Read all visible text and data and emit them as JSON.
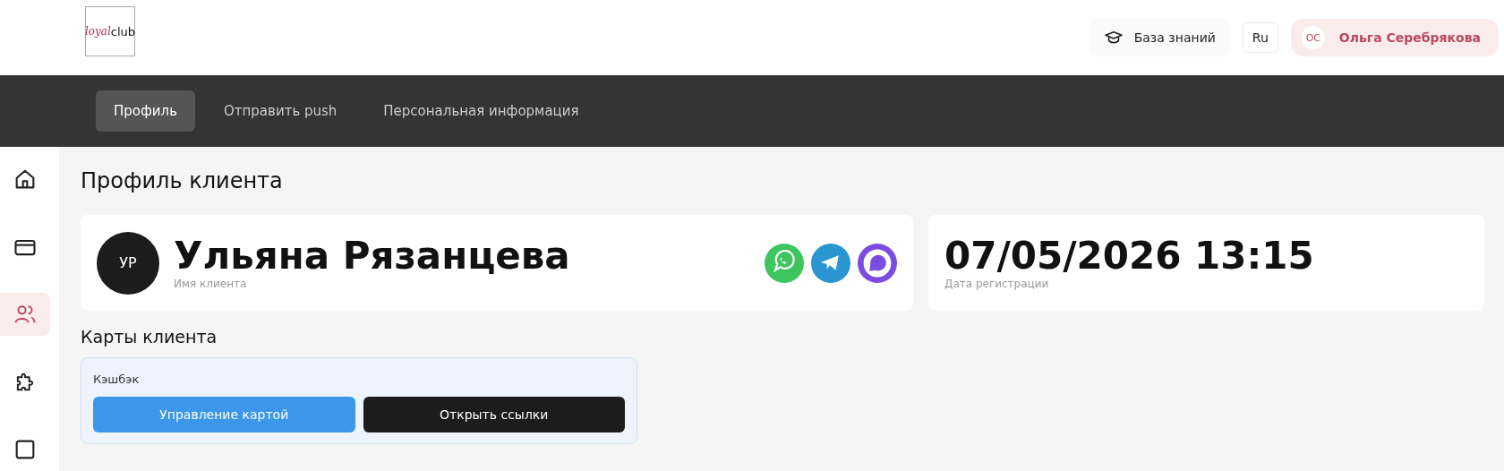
{
  "header": {
    "logo": {
      "part_1": "loyal",
      "part_2": "club"
    },
    "knowledge_base": "База знаний",
    "language": "Ru",
    "user": {
      "initials": "ОС",
      "name": "Ольга Серебрякова"
    }
  },
  "tabs": [
    {
      "label": "Профиль",
      "selected": true
    },
    {
      "label": "Отправить push",
      "selected": false
    },
    {
      "label": "Персональная информация",
      "selected": false
    }
  ],
  "sidebar": {
    "items": [
      {
        "kind": "home",
        "selected": false
      },
      {
        "kind": "card",
        "selected": false
      },
      {
        "kind": "users",
        "selected": true
      },
      {
        "kind": "puzzle",
        "selected": false
      },
      {
        "kind": "square",
        "selected": false
      }
    ]
  },
  "page_title": "Профиль клиента",
  "client": {
    "initials": "УР",
    "name": "Ульяна Рязанцева",
    "name_caption": "Имя клиента",
    "messengers": [
      {
        "kind": "whatsapp"
      },
      {
        "kind": "telegram"
      },
      {
        "kind": "max"
      }
    ]
  },
  "registration": {
    "value": "07/05/2026 13:15",
    "caption": "Дата регистрации"
  },
  "cards_title": "Карты клиента",
  "cards": [
    {
      "title": "Кэшбэк",
      "buttons": [
        {
          "label": "Управление картой",
          "kind": "primary"
        },
        {
          "label": "Открыть ссылки",
          "kind": "dark"
        }
      ]
    }
  ]
}
